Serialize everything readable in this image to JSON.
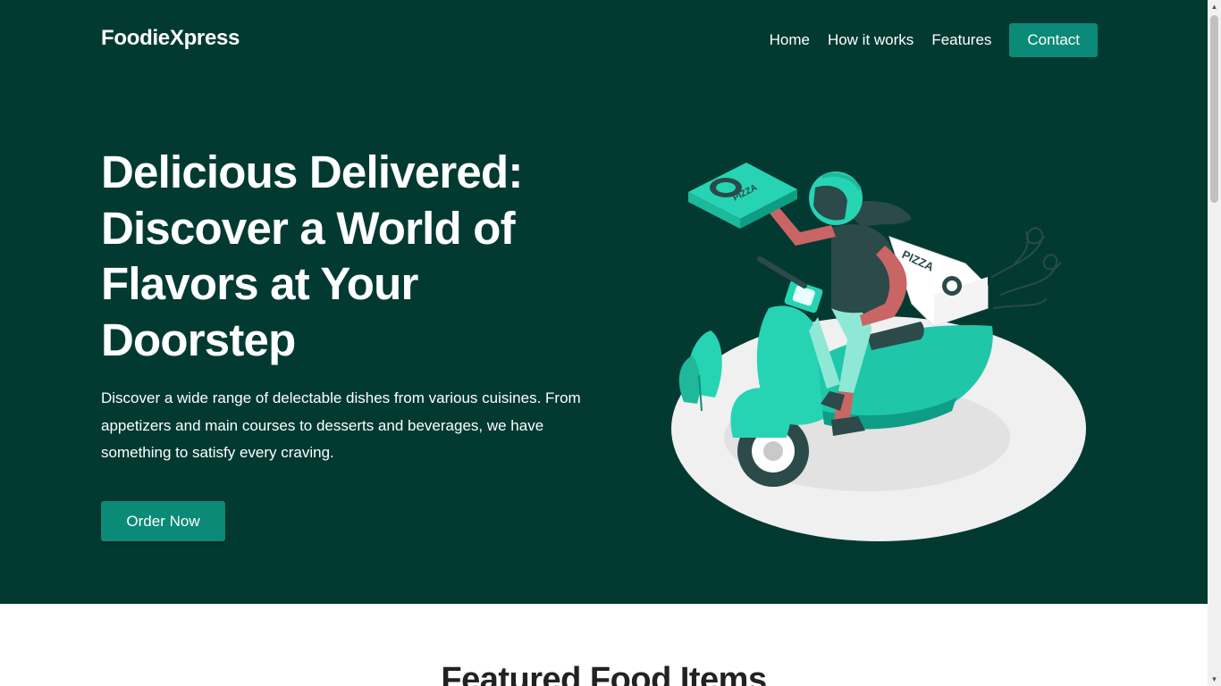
{
  "nav": {
    "brand": "FoodieXpress",
    "links": [
      "Home",
      "How it works",
      "Features"
    ],
    "contact_label": "Contact"
  },
  "hero": {
    "headline": "Delicious Delivered: Discover a World of Flavors at Your Doorstep",
    "description": "Discover a wide range of delectable dishes from various cuisines. From appetizers and main courses to desserts and beverages, we have something to satisfy every craving.",
    "cta_label": "Order Now",
    "illustration": {
      "box_label": "PIZZA",
      "icon": "delivery-scooter-illustration"
    }
  },
  "featured": {
    "title": "Featured Food Items"
  },
  "colors": {
    "hero_bg": "#023a32",
    "accent": "#0b8a78",
    "teal": "#26d4b4"
  }
}
